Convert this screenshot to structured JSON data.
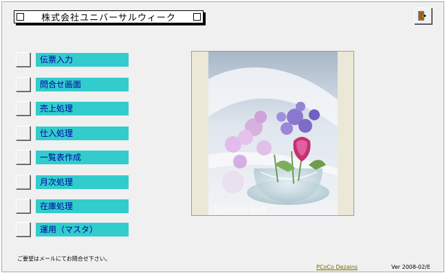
{
  "header": {
    "title": "株式会社ユニバーサルウィーク"
  },
  "menu": {
    "items": [
      {
        "label": "伝票入力"
      },
      {
        "label": "問合せ画面"
      },
      {
        "label": "売上処理"
      },
      {
        "label": "仕入処理"
      },
      {
        "label": "一覧表作成"
      },
      {
        "label": "月次処理"
      },
      {
        "label": "在庫処理"
      },
      {
        "label": "運用（マスタ）"
      }
    ]
  },
  "image": {
    "watermark": "Solution Soft"
  },
  "footer": {
    "note": "ご要望はメールにてお問合せ下さい。",
    "link": "PCoCo Dezains",
    "version": "Ver 2008-02/E"
  },
  "colors": {
    "menu_label_bg": "#33cccc",
    "menu_label_text": "#0000a0",
    "window_bg": "#f0f0f0"
  },
  "icons": {
    "exit": "exit-door-icon"
  }
}
